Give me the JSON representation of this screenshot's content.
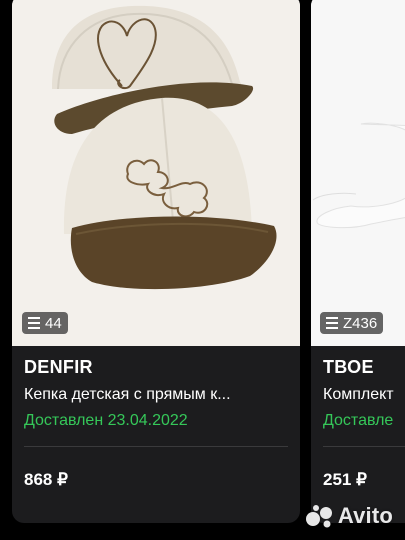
{
  "products": [
    {
      "badge_icon": "list-icon",
      "badge_count": "44",
      "brand": "DENFIR",
      "title": "Кепка детская с прямым к...",
      "status": "Доставлен 23.04.2022",
      "price": "868 ₽"
    },
    {
      "badge_icon": "list-icon",
      "badge_count": "Z436",
      "brand": "ТВОЕ",
      "title": "Комплект",
      "status": "Доставле",
      "price": "251 ₽"
    }
  ],
  "watermark": {
    "text": "Avito",
    "icon": "avito-logo-icon"
  },
  "colors": {
    "status_green": "#35c759",
    "card_bg": "#1c1c1e",
    "page_bg": "#000000"
  }
}
